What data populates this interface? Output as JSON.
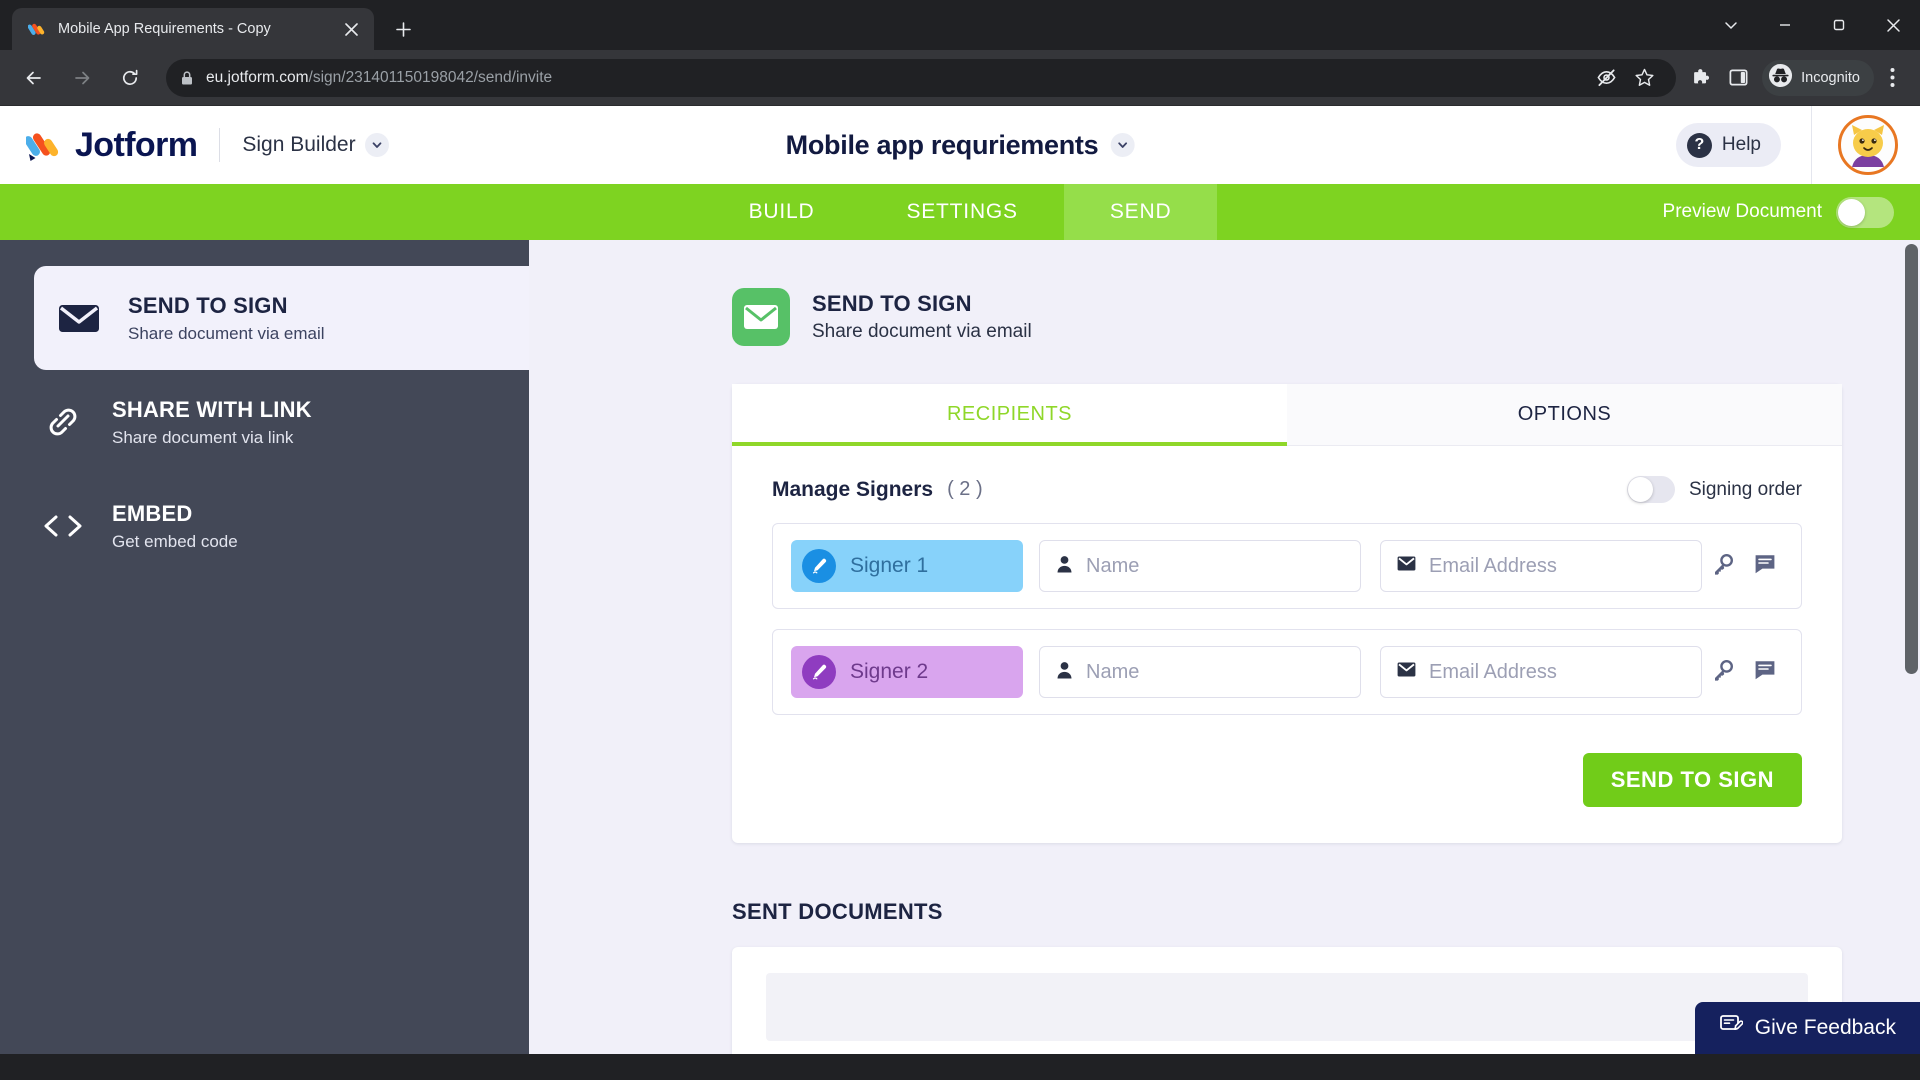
{
  "browser": {
    "tab": {
      "title": "Mobile App Requirements - Copy",
      "favicon_icon": "jotform-favicon",
      "close_icon": "close-icon"
    },
    "newtab_icon": "plus-icon",
    "window_controls": [
      {
        "name": "minimize-to-tray-chevron",
        "icon": "chevron-down-icon"
      },
      {
        "name": "minimize",
        "icon": "minimize-icon"
      },
      {
        "name": "maximize",
        "icon": "maximize-icon"
      },
      {
        "name": "close",
        "icon": "close-icon"
      }
    ],
    "nav": {
      "back_icon": "back-arrow-icon",
      "forward_icon": "forward-arrow-icon",
      "reload_icon": "reload-icon"
    },
    "omnibox": {
      "lock_icon": "lock-icon",
      "url_domain": "eu.jotform.com",
      "url_path": "/sign/231401150198042/send/invite"
    },
    "toolbar_icons": [
      {
        "name": "eye-slash-icon",
        "label": ""
      },
      {
        "name": "star-bookmark-icon",
        "label": ""
      },
      {
        "name": "extensions-puzzle-icon",
        "label": ""
      },
      {
        "name": "side-panel-icon",
        "label": ""
      }
    ],
    "incognito": {
      "label": "Incognito",
      "icon": "incognito-icon"
    },
    "menu_icon": "three-dot-menu-icon"
  },
  "header": {
    "logo_text": "Jotform",
    "product": "Sign Builder",
    "product_chevron_icon": "chevron-down-icon",
    "document_title": "Mobile app requriements",
    "document_chevron_icon": "chevron-down-icon",
    "help_label": "Help",
    "help_icon": "question-mark-icon",
    "avatar_icon": "cat-avatar"
  },
  "nav_bar": {
    "tabs": [
      {
        "label": "BUILD",
        "active": false
      },
      {
        "label": "SETTINGS",
        "active": false
      },
      {
        "label": "SEND",
        "active": true
      }
    ],
    "preview_label": "Preview Document",
    "preview_enabled": false,
    "background_color": "#7ed321",
    "active_tab_color": "#95de4a"
  },
  "sidebar": {
    "items": [
      {
        "title": "SEND TO SIGN",
        "subtitle": "Share document via email",
        "icon": "envelope-icon",
        "active": true
      },
      {
        "title": "SHARE WITH LINK",
        "subtitle": "Share document via link",
        "icon": "link-chain-icon",
        "active": false
      },
      {
        "title": "EMBED",
        "subtitle": "Get embed code",
        "icon": "code-brackets-icon",
        "active": false
      }
    ]
  },
  "main": {
    "heading": {
      "title": "SEND TO SIGN",
      "subtitle": "Share document via email",
      "icon": "envelope-icon",
      "icon_color": "#57c167"
    },
    "tabs": [
      {
        "label": "RECIPIENTS",
        "active": true
      },
      {
        "label": "OPTIONS",
        "active": false
      }
    ],
    "signers_section": {
      "title": "Manage Signers",
      "count": "( 2 )",
      "signing_order_label": "Signing order",
      "signing_order_enabled": false,
      "name_placeholder": "Name",
      "email_placeholder": "Email Address",
      "name_icon": "person-icon",
      "email_icon": "envelope-icon",
      "key_icon": "key-icon",
      "message_icon": "message-icon",
      "rows": [
        {
          "label": "Signer 1",
          "color": "#87d2fa",
          "badge_icon": "signature-pen-icon",
          "name_value": "",
          "email_value": ""
        },
        {
          "label": "Signer 2",
          "color": "#d9a5ee",
          "badge_icon": "signature-pen-icon",
          "name_value": "",
          "email_value": ""
        }
      ]
    },
    "send_button": "SEND TO SIGN",
    "sent_documents_title": "SENT DOCUMENTS"
  },
  "feedback": {
    "label": "Give Feedback",
    "icon": "feedback-pencil-icon"
  }
}
